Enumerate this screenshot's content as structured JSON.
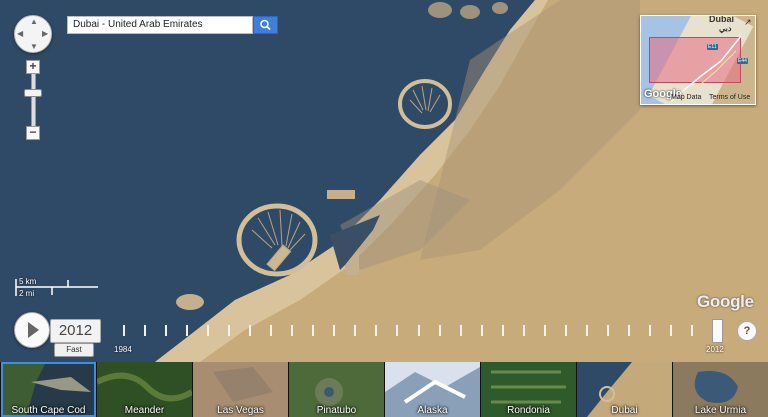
{
  "search": {
    "value": "Dubai - United Arab Emirates"
  },
  "minimap": {
    "city": "Dubai",
    "city_native": "دبي",
    "shields": [
      "E11",
      "E44"
    ],
    "google": "Google",
    "map_data": "Map Data",
    "terms": "Terms of Use"
  },
  "scale": {
    "km": "5 km",
    "mi": "2 mi"
  },
  "watermark": "Google",
  "timeline": {
    "current_year": "2012",
    "speed": "Fast",
    "start_label": "1984",
    "end_label": "2012",
    "help": "?"
  },
  "thumbnails": [
    {
      "label": "South Cape Cod",
      "selected": true
    },
    {
      "label": "Meander"
    },
    {
      "label": "Las Vegas"
    },
    {
      "label": "Pinatubo"
    },
    {
      "label": "Alaska"
    },
    {
      "label": "Rondonia"
    },
    {
      "label": "Dubai"
    },
    {
      "label": "Lake Urmia"
    }
  ],
  "colors": {
    "sea": "#2f4a66",
    "desert": "#c7ab7a",
    "accent": "#3f7fdc",
    "selected_outline": "#3b8fe6"
  }
}
